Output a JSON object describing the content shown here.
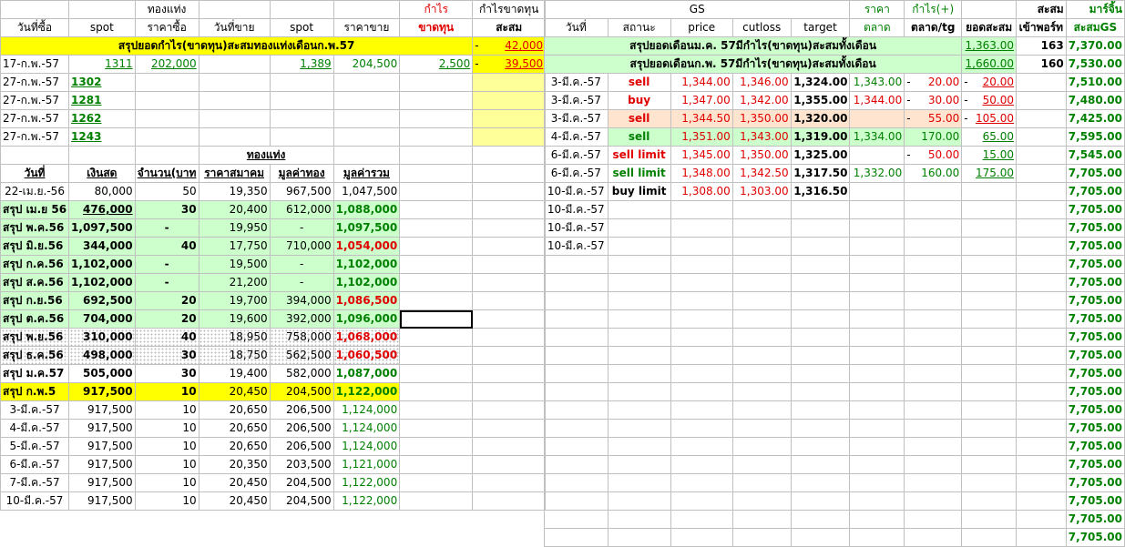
{
  "left": {
    "header1": [
      "",
      "",
      "ทองแท่ง",
      "",
      "",
      "",
      "กำไร",
      "กำไรขาดทุน"
    ],
    "header2": [
      "วันที่ซื้อ",
      "spot",
      "ราคาซื้อ",
      "วันที่ขาย",
      "spot",
      "ราคาขาย",
      "ขาดทุน",
      "สะสม"
    ],
    "summary": {
      "label": "สรุปยอดกำไร(ขาดทุน)สะสมทองแท่งเดือนก.พ.57",
      "minus": "-",
      "value": "42,000"
    },
    "trade1": {
      "date": "17-ก.พ.-57",
      "spot": "1311",
      "buy": "202,000",
      "sell_spot": "1,389",
      "sell": "204,500",
      "profit": "2,500",
      "minus": "-",
      "cum": "39,500"
    },
    "open_trades": [
      {
        "date": "27-ก.พ.-57",
        "spot": "1302"
      },
      {
        "date": "27-ก.พ.-57",
        "spot": "1281"
      },
      {
        "date": "27-ก.พ.-57",
        "spot": "1262"
      },
      {
        "date": "27-ก.พ.-57",
        "spot": "1243"
      }
    ],
    "section_title": "ทองแท่ง",
    "sub_headers": [
      "วันที่",
      "เงินสด",
      "จำนวน(บาท",
      "ราคาสมาคม",
      "มูลค่าทอง",
      "มูลค่ารวม"
    ],
    "rows": [
      {
        "date": "22-เม.ย.-56",
        "cash": "80,000",
        "qty": "50",
        "price": "19,350",
        "gold": "967,500",
        "total": "1,047,500",
        "style": "plain",
        "total_color": "black"
      },
      {
        "date": "สรุป เม.ย 56",
        "cash": "476,000",
        "qty": "30",
        "price": "20,400",
        "gold": "612,000",
        "total": "1,088,000",
        "style": "green",
        "total_color": "green"
      },
      {
        "date": "สรุป พ.ค.56",
        "cash": "1,097,500",
        "qty": "-",
        "price": "19,950",
        "gold": "-",
        "total": "1,097,500",
        "style": "green",
        "total_color": "green"
      },
      {
        "date": "สรุป มิ.ย.56",
        "cash": "344,000",
        "qty": "40",
        "price": "17,750",
        "gold": "710,000",
        "total": "1,054,000",
        "style": "green",
        "total_color": "red"
      },
      {
        "date": "สรุป ก.ค.56",
        "cash": "1,102,000",
        "qty": "-",
        "price": "19,500",
        "gold": "-",
        "total": "1,102,000",
        "style": "green",
        "total_color": "green"
      },
      {
        "date": "สรุป ส.ค.56",
        "cash": "1,102,000",
        "qty": "-",
        "price": "21,200",
        "gold": "-",
        "total": "1,102,000",
        "style": "green",
        "total_color": "green"
      },
      {
        "date": "สรุป ก.ย.56",
        "cash": "692,500",
        "qty": "20",
        "price": "19,700",
        "gold": "394,000",
        "total": "1,086,500",
        "style": "green",
        "total_color": "red"
      },
      {
        "date": "สรุป ต.ค.56",
        "cash": "704,000",
        "qty": "20",
        "price": "19,600",
        "gold": "392,000",
        "total": "1,096,000",
        "style": "green",
        "total_color": "green"
      },
      {
        "date": "สรุป พ.ย.56",
        "cash": "310,000",
        "qty": "40",
        "price": "18,950",
        "gold": "758,000",
        "total": "1,068,000",
        "style": "dots",
        "total_color": "red"
      },
      {
        "date": "สรุป ธ.ค.56",
        "cash": "498,000",
        "qty": "30",
        "price": "18,750",
        "gold": "562,500",
        "total": "1,060,500",
        "style": "dots",
        "total_color": "red"
      },
      {
        "date": "สรุป ม.ค.57",
        "cash": "505,000",
        "qty": "30",
        "price": "19,400",
        "gold": "582,000",
        "total": "1,087,000",
        "style": "plainbold",
        "total_color": "green"
      },
      {
        "date": "สรุป ก.พ.5",
        "cash": "917,500",
        "qty": "10",
        "price": "20,450",
        "gold": "204,500",
        "total": "1,122,000",
        "style": "yellow",
        "total_color": "green"
      },
      {
        "date": "3-มี.ค.-57",
        "cash": "917,500",
        "qty": "10",
        "price": "20,650",
        "gold": "206,500",
        "total": "1,124,000",
        "style": "plain",
        "total_color": "green"
      },
      {
        "date": "4-มี.ค.-57",
        "cash": "917,500",
        "qty": "10",
        "price": "20,650",
        "gold": "206,500",
        "total": "1,124,000",
        "style": "plain",
        "total_color": "green"
      },
      {
        "date": "5-มี.ค.-57",
        "cash": "917,500",
        "qty": "10",
        "price": "20,650",
        "gold": "206,500",
        "total": "1,124,000",
        "style": "plain",
        "total_color": "green"
      },
      {
        "date": "6-มี.ค.-57",
        "cash": "917,500",
        "qty": "10",
        "price": "20,350",
        "gold": "203,500",
        "total": "1,121,000",
        "style": "plain",
        "total_color": "green"
      },
      {
        "date": "7-มี.ค.-57",
        "cash": "917,500",
        "qty": "10",
        "price": "20,450",
        "gold": "204,500",
        "total": "1,122,000",
        "style": "plain",
        "total_color": "green"
      },
      {
        "date": "10-มี.ค.-57",
        "cash": "917,500",
        "qty": "10",
        "price": "20,450",
        "gold": "204,500",
        "total": "1,122,000",
        "style": "plain",
        "total_color": "green"
      }
    ]
  },
  "right": {
    "gs_title": "GS",
    "h1_price": "ราคา",
    "h1_profit": "กำไร(+)",
    "h1_accum": "สะสม",
    "h1_margin": "มาร์จิ้น",
    "headers": [
      "วันที่",
      "สถานะ",
      "price",
      "cutloss",
      "target",
      "ตลาด",
      "ตลาด/tg",
      "ยอดสะสม",
      "เข้าพอร์ท",
      "สะสมGS"
    ],
    "sum1": {
      "label": "สรุปยอดเดือนม.ค. 57มีกำไร(ขาดทุน)สะสมทั้งเดือน",
      "value": "1,363.00",
      "port": "163",
      "margin": "7,370.00"
    },
    "sum2": {
      "label": "สรุปยอดเดือนก.พ. 57มีกำไร(ขาดทุน)สะสมทั้งเดือน",
      "value": "1,660.00",
      "port": "160",
      "margin": "7,530.00"
    },
    "trades": [
      {
        "date": "3-มี.ค.-57",
        "status": "sell",
        "status_color": "red",
        "price": "1,344.00",
        "cutloss": "1,346.00",
        "target": "1,324.00",
        "market": "1,343.00",
        "market_color": "green",
        "pl_minus": "-",
        "pl": "20.00",
        "pl_color": "red",
        "cum_minus": "-",
        "cum": "20.00",
        "cum_color": "red",
        "margin": "7,510.00",
        "bg": ""
      },
      {
        "date": "3-มี.ค.-57",
        "status": "buy",
        "status_color": "red",
        "price": "1,347.00",
        "cutloss": "1,342.00",
        "target": "1,355.00",
        "market": "1,344.00",
        "market_color": "red",
        "pl_minus": "-",
        "pl": "30.00",
        "pl_color": "red",
        "cum_minus": "-",
        "cum": "50.00",
        "cum_color": "red",
        "margin": "7,480.00",
        "bg": ""
      },
      {
        "date": "3-มี.ค.-57",
        "status": "sell",
        "status_color": "red",
        "price": "1,344.50",
        "cutloss": "1,350.00",
        "target": "1,320.00",
        "market": "",
        "market_color": "green",
        "pl_minus": "-",
        "pl": "55.00",
        "pl_color": "red",
        "cum_minus": "-",
        "cum": "105.00",
        "cum_color": "red",
        "margin": "7,425.00",
        "bg": "pink"
      },
      {
        "date": "4-มี.ค.-57",
        "status": "sell",
        "status_color": "green",
        "price": "1,351.00",
        "cutloss": "1,343.00",
        "target": "1,319.00",
        "market": "1,334.00",
        "market_color": "green",
        "pl_minus": "",
        "pl": "170.00",
        "pl_color": "green",
        "cum_minus": "",
        "cum": "65.00",
        "cum_color": "green",
        "margin": "7,595.00",
        "bg": "green"
      },
      {
        "date": "6-มี.ค.-57",
        "status": "sell limit",
        "status_color": "red",
        "price": "1,345.00",
        "cutloss": "1,350.00",
        "target": "1,325.00",
        "market": "",
        "market_color": "green",
        "pl_minus": "-",
        "pl": "50.00",
        "pl_color": "red",
        "cum_minus": "",
        "cum": "15.00",
        "cum_color": "green",
        "margin": "7,545.00",
        "bg": ""
      },
      {
        "date": "6-มี.ค.-57",
        "status": "sell limit",
        "status_color": "green",
        "price": "1,348.00",
        "cutloss": "1,342.50",
        "target": "1,317.50",
        "market": "1,332.00",
        "market_color": "green",
        "pl_minus": "",
        "pl": "160.00",
        "pl_color": "green",
        "cum_minus": "",
        "cum": "175.00",
        "cum_color": "green",
        "margin": "7,705.00",
        "bg": ""
      },
      {
        "date": "10-มี.ค.-57",
        "status": "buy limit",
        "status_color": "black",
        "price": "1,308.00",
        "cutloss": "1,303.00",
        "target": "1,316.50",
        "market": "",
        "market_color": "green",
        "pl_minus": "",
        "pl": "",
        "pl_color": "green",
        "cum_minus": "",
        "cum": "",
        "cum_color": "green",
        "margin": "7,705.00",
        "bg": ""
      },
      {
        "date": "10-มี.ค.-57",
        "status": "",
        "status_color": "black",
        "price": "",
        "cutloss": "",
        "target": "",
        "market": "",
        "market_color": "green",
        "pl_minus": "",
        "pl": "",
        "pl_color": "green",
        "cum_minus": "",
        "cum": "",
        "cum_color": "green",
        "margin": "7,705.00",
        "bg": ""
      },
      {
        "date": "10-มี.ค.-57",
        "status": "",
        "status_color": "black",
        "price": "",
        "cutloss": "",
        "target": "",
        "market": "",
        "market_color": "green",
        "pl_minus": "",
        "pl": "",
        "pl_color": "green",
        "cum_minus": "",
        "cum": "",
        "cum_color": "green",
        "margin": "7,705.00",
        "bg": ""
      },
      {
        "date": "10-มี.ค.-57",
        "status": "",
        "status_color": "black",
        "price": "",
        "cutloss": "",
        "target": "",
        "market": "",
        "market_color": "green",
        "pl_minus": "",
        "pl": "",
        "pl_color": "green",
        "cum_minus": "",
        "cum": "",
        "cum_color": "green",
        "margin": "7,705.00",
        "bg": ""
      }
    ],
    "margin_tail": [
      "7,705.00",
      "7,705.00",
      "7,705.00",
      "7,705.00",
      "7,705.00",
      "7,705.00",
      "7,705.00",
      "7,705.00",
      "7,705.00",
      "7,705.00",
      "7,705.00",
      "7,705.00",
      "7,705.00",
      "7,705.00",
      "7,705.00",
      "7,705.00"
    ]
  }
}
